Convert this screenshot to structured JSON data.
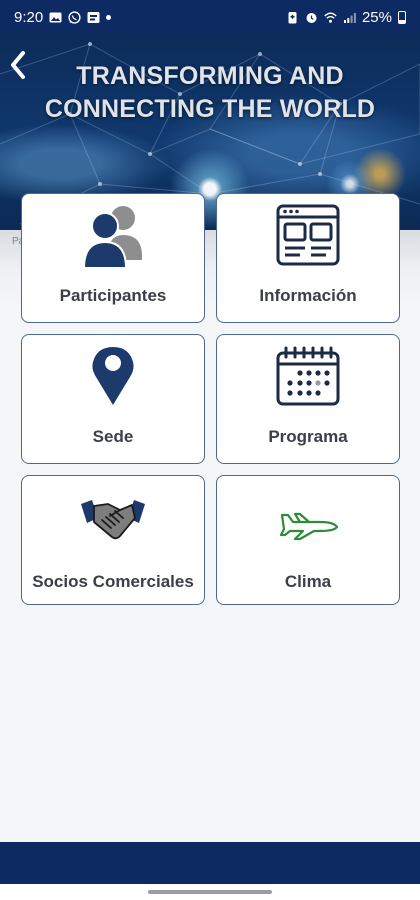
{
  "status_bar": {
    "time": "9:20",
    "left_icons": [
      "gallery-icon",
      "whatsapp-icon",
      "app-icon",
      "notification-dot"
    ],
    "right_icons": [
      "battery-saver-icon",
      "alarm-icon",
      "wifi-icon",
      "signal-icon"
    ],
    "battery": "25%"
  },
  "header": {
    "title_line1": "TRANSFORMING AND",
    "title_line2": "CONNECTING THE WORLD",
    "back_icon": "chevron-left-icon",
    "behind_text": "Pa"
  },
  "menu": {
    "participantes": "Participantes",
    "informacion": "Información",
    "sede": "Sede",
    "programa": "Programa",
    "socios": "Socios Comerciales",
    "clima": "Clima"
  },
  "colors": {
    "brand_navy": "#0d2a63",
    "icon_navy": "#1c3a6b",
    "tile_border": "#4d6891",
    "plane_green": "#2e8b3a"
  }
}
